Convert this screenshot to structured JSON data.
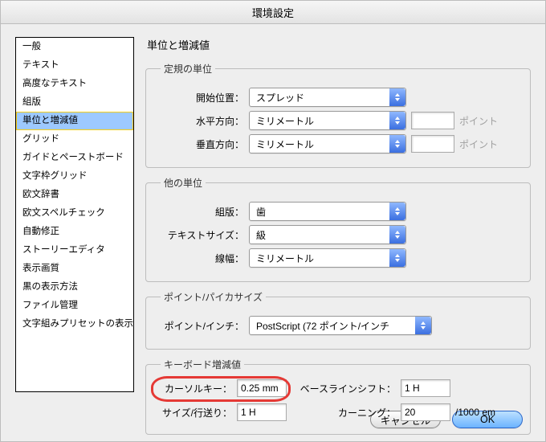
{
  "window": {
    "title": "環境設定"
  },
  "sidebar": {
    "items": [
      "一般",
      "テキスト",
      "高度なテキスト",
      "組版",
      "単位と増減値",
      "グリッド",
      "ガイドとペーストボード",
      "文字枠グリッド",
      "欧文辞書",
      "欧文スペルチェック",
      "自動修正",
      "ストーリーエディタ",
      "表示画質",
      "黒の表示方法",
      "ファイル管理",
      "文字組みプリセットの表示設定"
    ],
    "selected_index": 4
  },
  "main": {
    "heading": "単位と増減値"
  },
  "ruler_units": {
    "legend": "定規の単位",
    "origin": {
      "label": "開始位置：",
      "value": "スプレッド"
    },
    "horizontal": {
      "label": "水平方向：",
      "value": "ミリメートル",
      "points_input": "",
      "points_unit": "ポイント"
    },
    "vertical": {
      "label": "垂直方向：",
      "value": "ミリメートル",
      "points_input": "",
      "points_unit": "ポイント"
    }
  },
  "other_units": {
    "legend": "他の単位",
    "layout": {
      "label": "組版：",
      "value": "歯"
    },
    "text_size": {
      "label": "テキストサイズ：",
      "value": "級"
    },
    "line": {
      "label": "線幅：",
      "value": "ミリメートル"
    }
  },
  "point_pica": {
    "legend": "ポイント/パイカサイズ",
    "label": "ポイント/インチ：",
    "value": "PostScript (72 ポイント/インチ"
  },
  "keyboard_increment": {
    "legend": "キーボード増減値",
    "cursor_key": {
      "label": "カーソルキー：",
      "value": "0.25 mm"
    },
    "baseline_shift": {
      "label": "ベースラインシフト：",
      "value": "1 H"
    },
    "size_leading": {
      "label": "サイズ/行送り：",
      "value": "1 H"
    },
    "kerning": {
      "label": "カーニング：",
      "value": "20",
      "trail": "/1000 em"
    }
  },
  "buttons": {
    "cancel": "キャンセル",
    "ok": "OK"
  }
}
